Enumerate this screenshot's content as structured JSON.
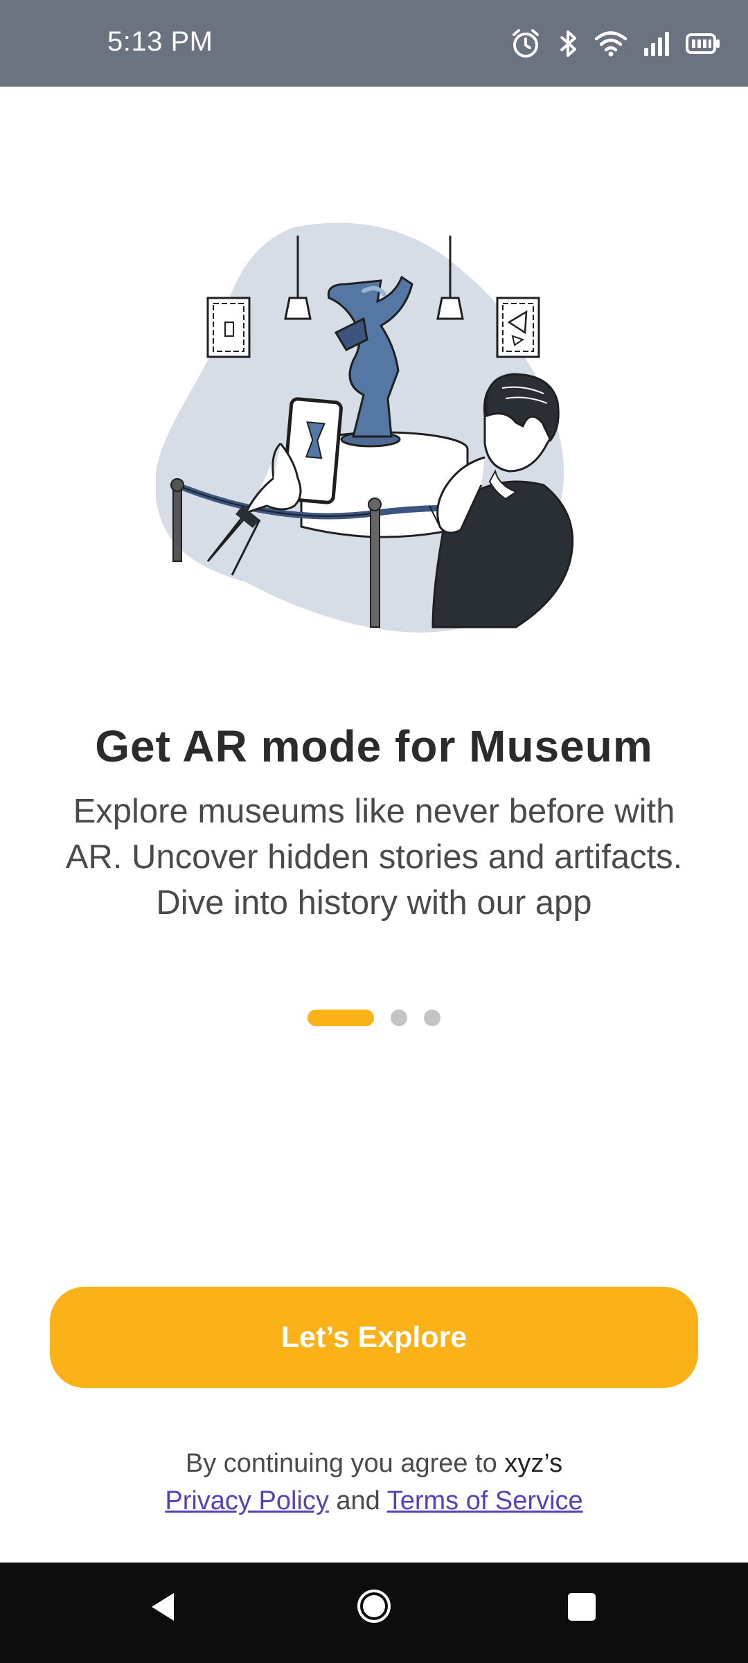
{
  "status_bar": {
    "time": "5:13 PM",
    "icons": [
      "alarm-icon",
      "bluetooth-icon",
      "wifi-icon",
      "signal-icon",
      "battery-icon"
    ]
  },
  "onboarding": {
    "illustration": "museum-ar-illustration",
    "title": "Get AR mode for Museum",
    "subtitle": "Explore museums like never before with AR. Uncover hidden stories and artifacts. Dive into history with our app",
    "pager": {
      "total": 3,
      "active_index": 0
    }
  },
  "cta": {
    "label": "Let’s Explore"
  },
  "legal": {
    "prefix": "By continuing you agree to",
    "brand": "xyz’s",
    "privacy_link": "Privacy Policy",
    "and": "and",
    "terms_link": "Terms of Service"
  },
  "colors": {
    "accent": "#fbb118",
    "link": "#5b3fb8",
    "status_bar": "#6b7280",
    "nav_bar": "#0d0d0d"
  },
  "nav": {
    "icons": [
      "back-icon",
      "home-icon",
      "recents-icon"
    ]
  }
}
